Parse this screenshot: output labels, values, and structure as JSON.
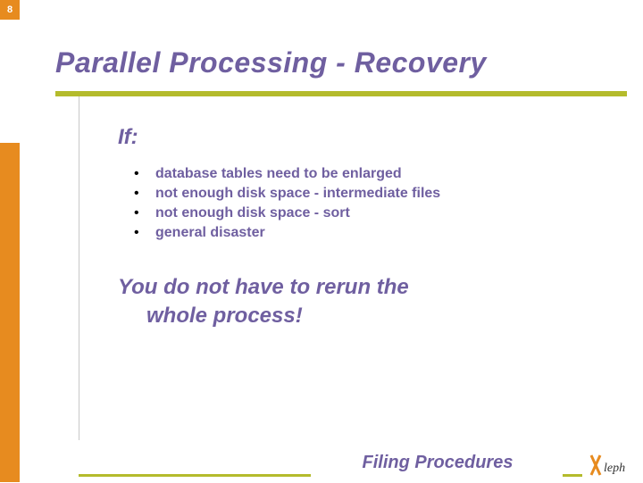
{
  "page_number": "8",
  "title": "Parallel Processing - Recovery",
  "if_label": "If:",
  "bullets": [
    "database tables need to be enlarged",
    "not enough disk space - intermediate files",
    "not enough disk space - sort",
    "general disaster"
  ],
  "conclusion_line1": "You do not have to rerun the",
  "conclusion_line2": "whole process!",
  "footer_title": "Filing Procedures",
  "logo_text": "Aleph"
}
